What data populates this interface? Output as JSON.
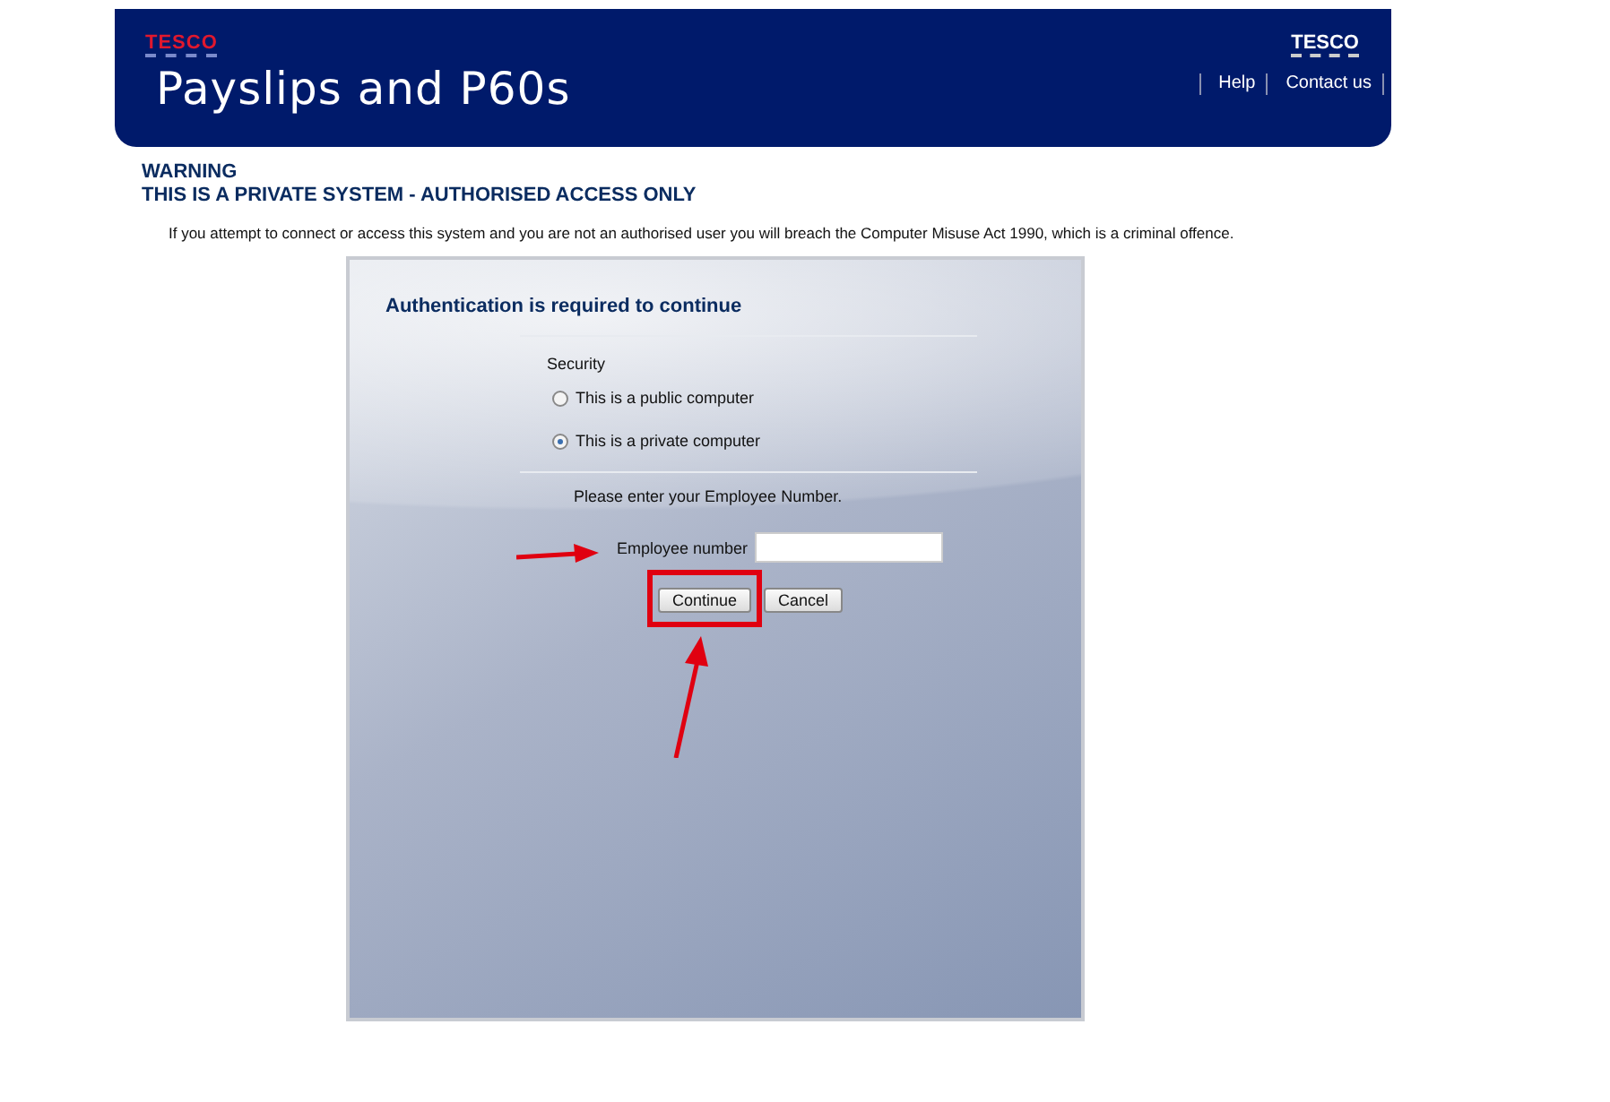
{
  "header": {
    "logo": "TESCO",
    "title": "Payslips and P60s",
    "right_logo": "TESCO",
    "links": [
      "Help",
      "Contact us"
    ]
  },
  "warning": {
    "heading": "WARNING",
    "subheading": "THIS IS A PRIVATE SYSTEM - AUTHORISED ACCESS ONLY",
    "notice": "If you attempt to connect or access this system and you are not an authorised user you will breach the Computer Misuse Act 1990, which is a criminal offence."
  },
  "panel": {
    "title": "Authentication is required to continue",
    "security_label": "Security",
    "options": [
      {
        "label": "This is a public computer",
        "selected": false
      },
      {
        "label": "This is a private computer",
        "selected": true
      }
    ],
    "prompt": "Please enter your Employee Number.",
    "field_label": "Employee number",
    "buttons": [
      {
        "label": "Continue",
        "highlighted": true
      },
      {
        "label": "Cancel",
        "highlighted": false
      }
    ]
  }
}
